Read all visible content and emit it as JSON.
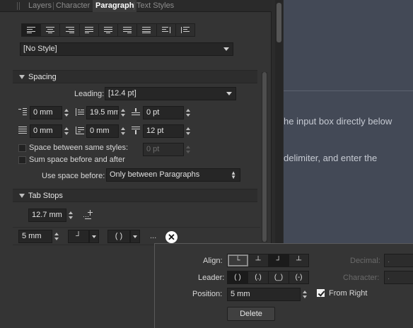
{
  "tabs": [
    {
      "label": "Layers",
      "active": false
    },
    {
      "label": "Character",
      "active": false
    },
    {
      "label": "Paragraph",
      "active": true
    },
    {
      "label": "Text Styles",
      "active": false
    }
  ],
  "alignment_buttons": [
    "align-left-icon",
    "align-center-icon",
    "align-right-icon",
    "justify-left-icon",
    "justify-center-icon",
    "justify-right-icon",
    "justify-all-icon",
    "align-toward-spine-icon",
    "align-away-spine-icon"
  ],
  "style_dropdown": {
    "value": "[No Style]"
  },
  "spacing": {
    "header": "Spacing",
    "leading_label": "Leading:",
    "leading_value": "[12.4 pt]",
    "left_indent": "0 mm",
    "first_line_indent": "19.5 mm",
    "space_before": "0 pt",
    "right_indent": "0 mm",
    "last_line_indent": "0 mm",
    "space_after": "12 pt",
    "space_between_label": "Space between same styles:",
    "space_between_value": "0 pt",
    "sum_space_label": "Sum space before and after",
    "use_space_before_label": "Use space before:",
    "use_space_before_value": "Only between Paragraphs"
  },
  "tab_stops": {
    "header": "Tab Stops",
    "default_value": "12.7 mm",
    "row_position": "5 mm",
    "row_leader": "( )",
    "row_more": "..."
  },
  "document_lines": [
    "he input box directly below",
    "delimiter, and enter the"
  ],
  "popup": {
    "align_label": "Align:",
    "leader_label": "Leader:",
    "leader_options": [
      "( )",
      "(.)",
      "(_)",
      "(-)"
    ],
    "position_label": "Position:",
    "position_value": "5 mm",
    "from_right_label": "From Right",
    "from_right_checked": true,
    "decimal_label": "Decimal:",
    "decimal_value": ".",
    "character_label": "Character:",
    "character_value": ".",
    "delete_label": "Delete"
  }
}
